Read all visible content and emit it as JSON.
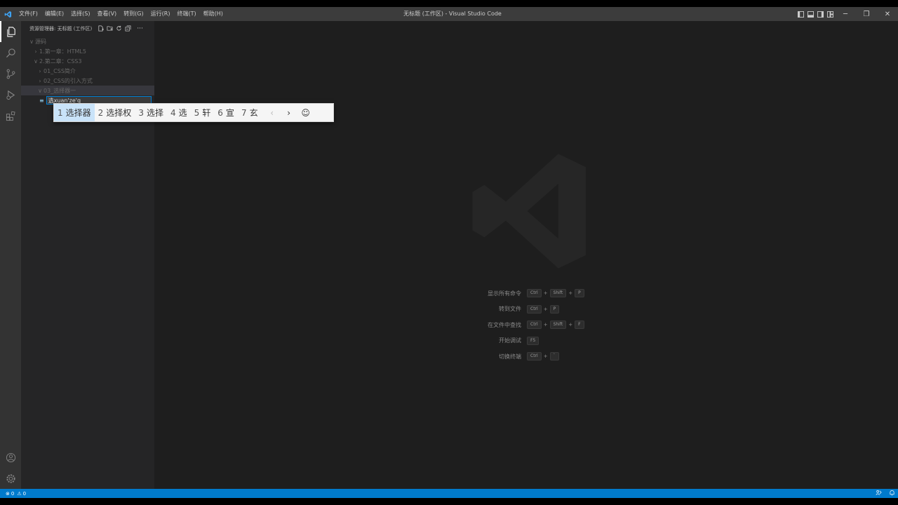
{
  "window": {
    "title": "无标题 (工作区) - Visual Studio Code",
    "controls": {
      "minimize": "─",
      "restore": "❐",
      "close": "✕"
    }
  },
  "menu": [
    "文件(F)",
    "编辑(E)",
    "选择(S)",
    "查看(V)",
    "转到(G)",
    "运行(R)",
    "终端(T)",
    "帮助(H)"
  ],
  "explorer": {
    "header": "资源管理器: 无标题 (工作区)",
    "items": [
      {
        "label": "源码",
        "chevron": "∨"
      },
      {
        "label": "1.第一章：HTML5",
        "chevron": "›"
      },
      {
        "label": "2.第二章：CSS3",
        "chevron": "∨"
      },
      {
        "label": "01_CSS简介",
        "chevron": "›"
      },
      {
        "label": "02_CSS的引入方式",
        "chevron": "›"
      },
      {
        "label": "03_选择器一",
        "chevron": "∨"
      }
    ],
    "rename_value": "选xuan'ze'q"
  },
  "ime": {
    "candidates": [
      {
        "num": "1",
        "text": "选择器"
      },
      {
        "num": "2",
        "text": "选择权"
      },
      {
        "num": "3",
        "text": "选择"
      },
      {
        "num": "4",
        "text": "选"
      },
      {
        "num": "5",
        "text": "轩"
      },
      {
        "num": "6",
        "text": "宣"
      },
      {
        "num": "7",
        "text": "玄"
      }
    ],
    "prev": "‹",
    "next": "›",
    "emoji": "☺"
  },
  "shortcuts": [
    {
      "label": "显示所有命令",
      "keys": [
        "Ctrl",
        "Shift",
        "P"
      ]
    },
    {
      "label": "转到文件",
      "keys": [
        "Ctrl",
        "P"
      ]
    },
    {
      "label": "在文件中查找",
      "keys": [
        "Ctrl",
        "Shift",
        "F"
      ]
    },
    {
      "label": "开始调试",
      "keys": [
        "F5"
      ]
    },
    {
      "label": "切换终端",
      "keys": [
        "Ctrl",
        "`"
      ]
    }
  ],
  "status": {
    "errors": "0",
    "warnings": "0"
  },
  "colors": {
    "accent": "#007acc",
    "titlebar": "#3c3c3c",
    "editor": "#1e1e1e",
    "sidebar": "#252526"
  }
}
